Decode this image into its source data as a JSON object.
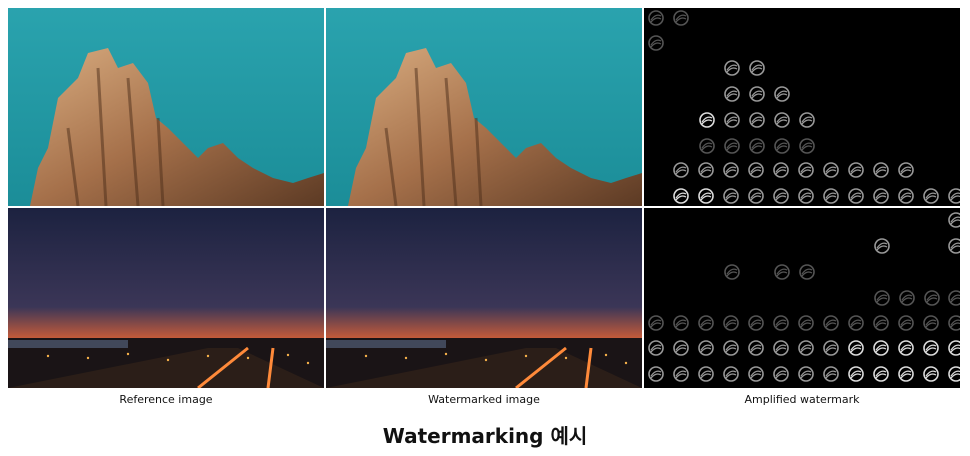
{
  "captions": [
    "Reference image",
    "Watermarked image",
    "Amplified watermark"
  ],
  "title": "Watermarking 예시",
  "colors": {
    "sky_top": "#2aa3ae",
    "sky_bottom": "#1b8d98",
    "rock_light": "#c99b72",
    "rock_dark": "#5c3a24",
    "night_sky_top": "#1c2240",
    "sunset_orange": "#e8703a",
    "watermark_bg": "#000000"
  }
}
